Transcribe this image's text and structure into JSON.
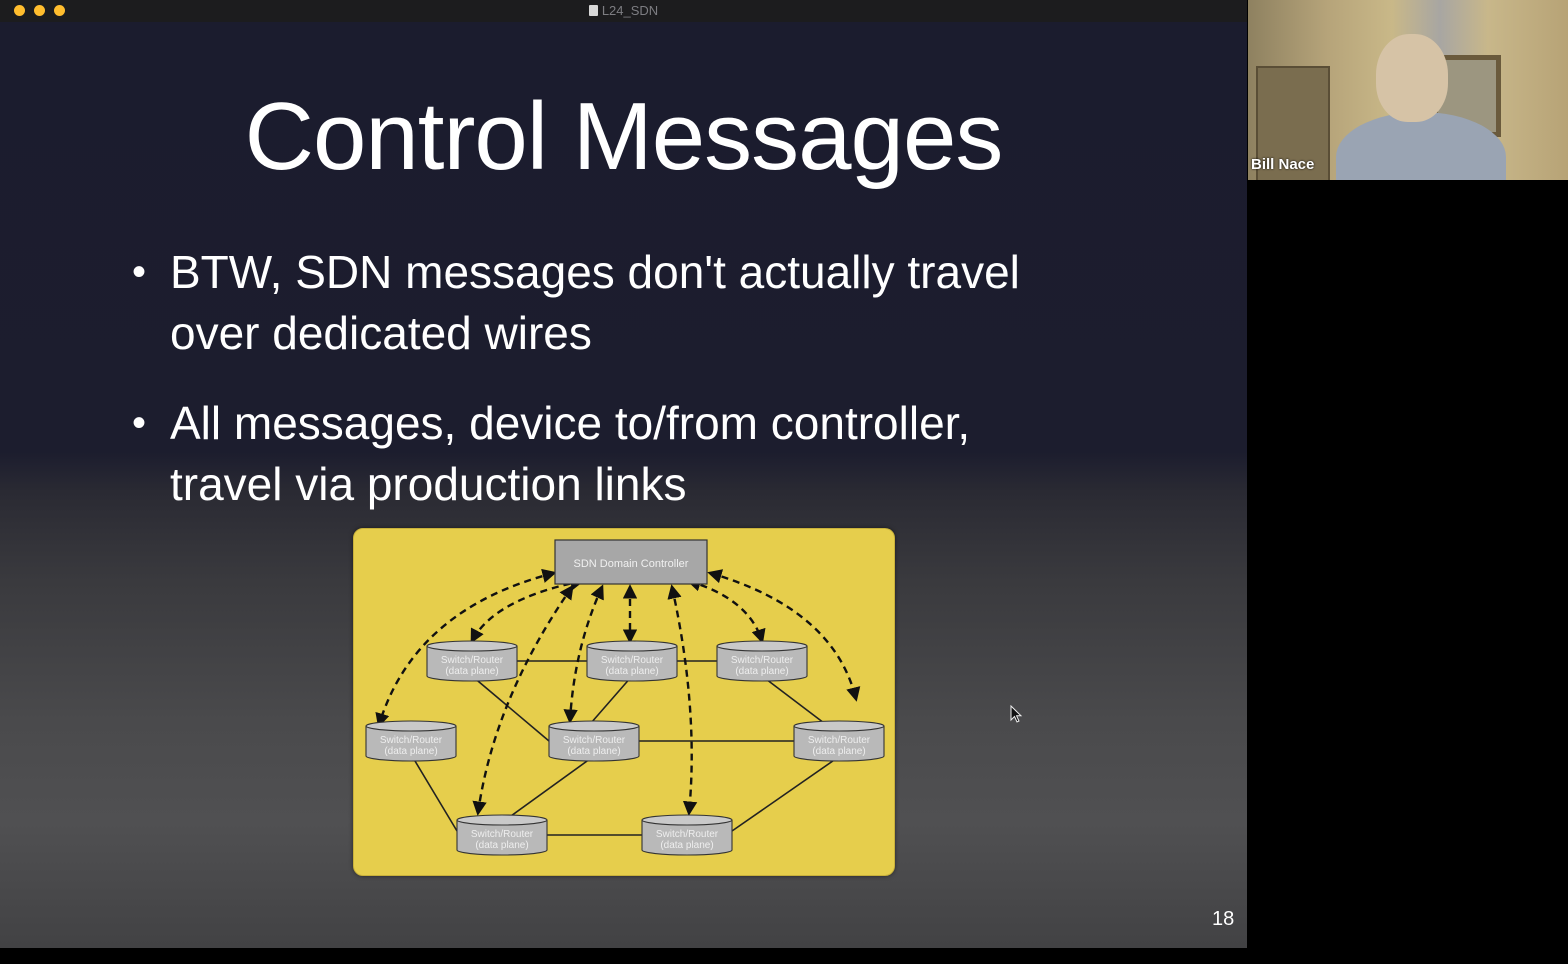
{
  "window": {
    "title": "L24_SDN"
  },
  "slide": {
    "title": "Control Messages",
    "bullets": [
      {
        "line1": "BTW, SDN messages don't actually travel",
        "line2": "over dedicated wires"
      },
      {
        "line1": "All messages, device to/from controller,",
        "line2": "travel via production links"
      }
    ],
    "page_number": "18",
    "diagram": {
      "controller_label": "SDN Domain Controller",
      "node_label_line1": "Switch/Router",
      "node_label_line2": "(data plane)"
    }
  },
  "video": {
    "participant_name": "Bill Nace"
  },
  "colors": {
    "slide_background": "#1b1c2e",
    "diagram_background": "#e6ce4c",
    "node_fill": "#b9b9b9",
    "traffic_light": "#ffbd2e"
  }
}
